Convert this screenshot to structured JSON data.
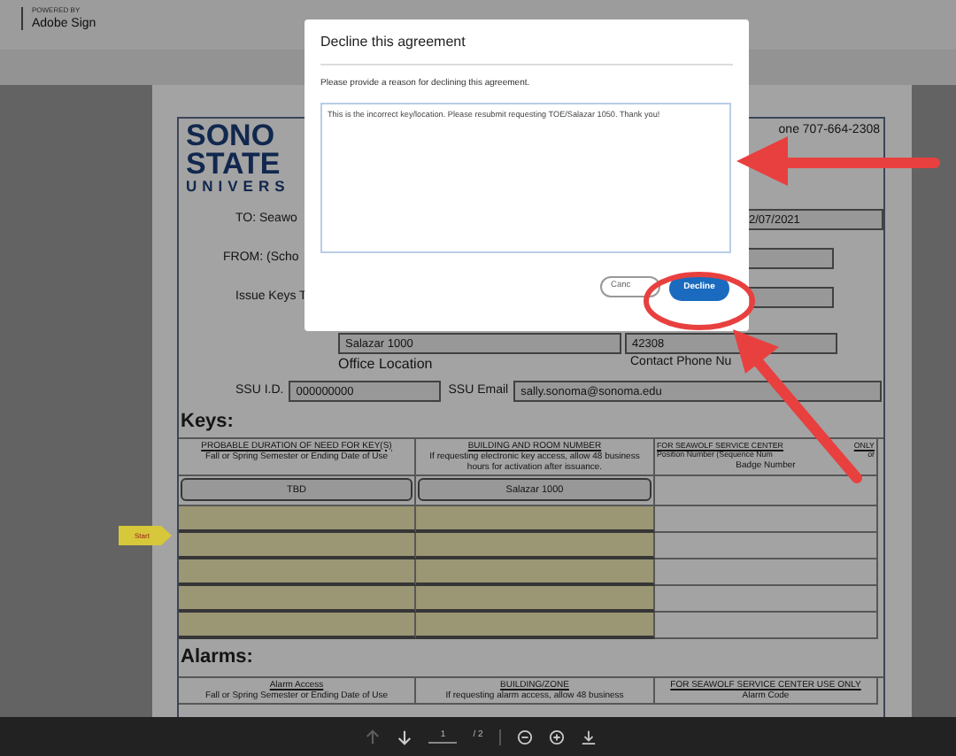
{
  "header": {
    "powered_by": "POWERED BY",
    "brand": "Adobe Sign"
  },
  "document": {
    "logo": [
      "SONO",
      "STATE",
      "UNIVERS"
    ],
    "phone": "one 707-664-2308",
    "fields": [
      {
        "label": "TO: Seawo",
        "value": "2/07/2021"
      },
      {
        "label": "FROM: (Scho"
      },
      {
        "label": "Issue Keys T"
      }
    ],
    "office": {
      "value": "Salazar 1000",
      "label": "Office Location"
    },
    "contact": {
      "value": "42308",
      "label": "Contact Phone Nu"
    },
    "ssu_id": {
      "label": "SSU I.D.",
      "value": "000000000"
    },
    "ssu_email": {
      "label": "SSU Email",
      "value": "sally.sonoma@sonoma.edu"
    },
    "keys": {
      "title": "Keys:",
      "columns": [
        {
          "title": "PROBABLE DURATION OF NEED FOR KEY(S)",
          "note": "Fall or Spring Semester or Ending Date of Use"
        },
        {
          "title": "BUILDING AND ROOM NUMBER",
          "note": "If requesting electronic key access, allow 48 business hours for activation after issuance."
        },
        {
          "title": "FOR SEAWOLF SERVICE CENTER",
          "title_end": "ONLY",
          "note": "Position Number (Sequence Num",
          "note_end": "or",
          "note_line2": "Badge Number"
        }
      ],
      "rows": [
        {
          "values": [
            "TBD",
            "Salazar 1000"
          ],
          "highlighted": false
        },
        {
          "highlighted": true
        },
        {
          "highlighted": true
        },
        {
          "highlighted": true
        },
        {
          "highlighted": true
        },
        {
          "highlighted": true
        }
      ]
    },
    "start_tag": "Start",
    "alarms": {
      "title": "Alarms:",
      "columns": [
        {
          "title": "Alarm Access",
          "note": "Fall or Spring Semester or Ending Date of Use"
        },
        {
          "title": "BUILDING/ZONE",
          "note": "If requesting alarm access, allow 48 business"
        },
        {
          "title": "FOR SEAWOLF SERVICE CENTER USE ONLY",
          "note": "Alarm Code"
        }
      ]
    }
  },
  "dialog": {
    "title": "Decline this agreement",
    "prompt": "Please provide a reason for declining this agreement.",
    "reason": "This is the incorrect key/location. Please resubmit requesting TOE/Salazar 1050. Thank you!",
    "buttons": [
      {
        "label": "Canc",
        "kind": "secondary"
      },
      {
        "label": "Decline",
        "kind": "primary"
      }
    ]
  },
  "toolbar": {
    "prev_disabled": true,
    "next_disabled": false,
    "page": "1",
    "total": "/ 2"
  }
}
